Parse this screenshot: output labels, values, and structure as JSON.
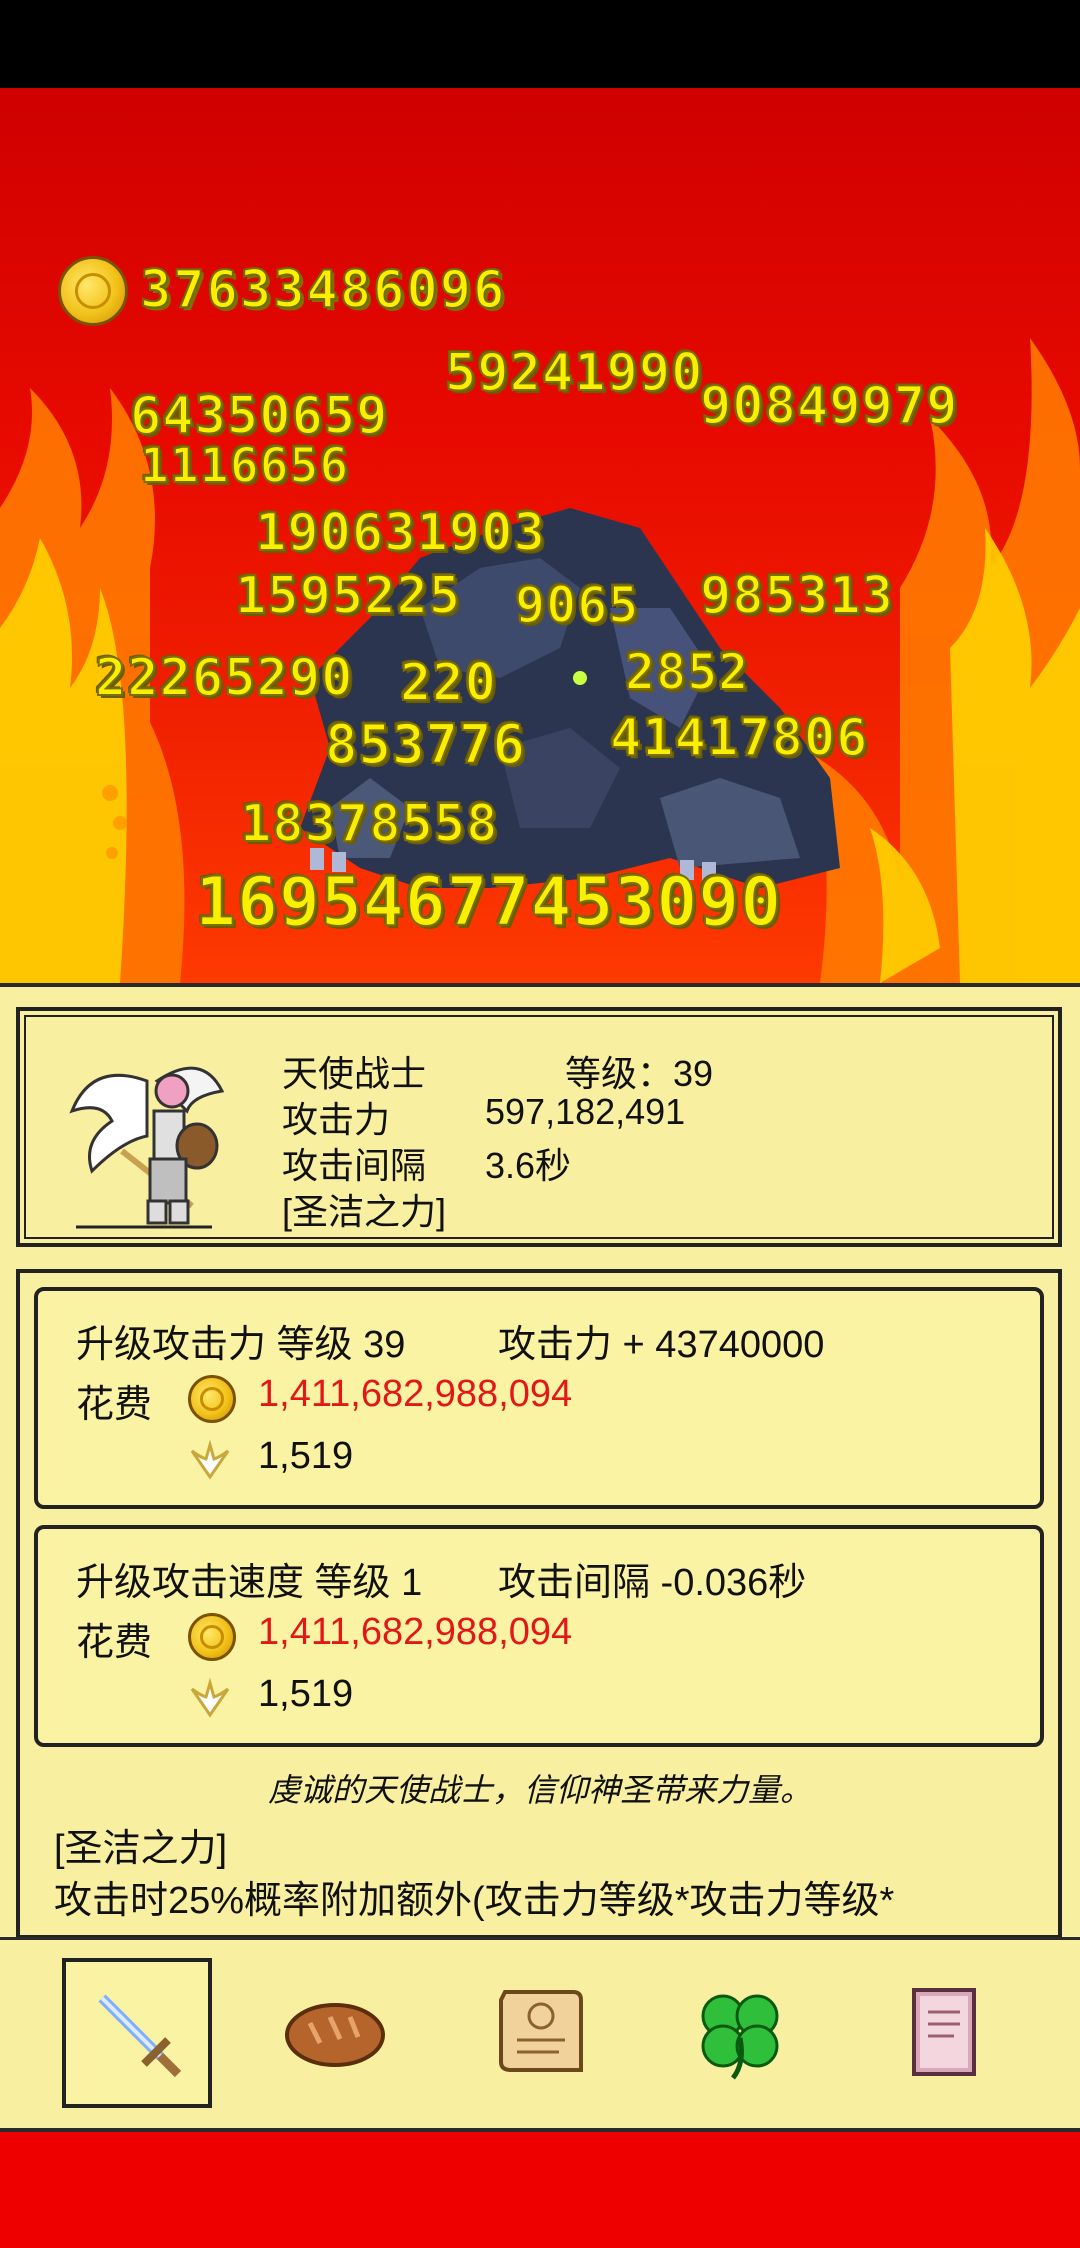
{
  "gold": {
    "icon": "gold-coin-icon",
    "amount": "37633486096"
  },
  "damage_numbers": [
    "59241990",
    "64350659",
    "90849979",
    "1116656",
    "190631903",
    "1595225",
    "9065",
    "985313",
    "22265290",
    "220",
    "2852",
    "853776",
    "41417806",
    "18378558"
  ],
  "big_damage": "16954677453090",
  "character": {
    "name": "天使战士",
    "level_label": "等级：39",
    "attack_label": "攻击力",
    "attack_value": "597,182,491",
    "interval_label": "攻击间隔",
    "interval_value": "3.6秒",
    "skill": "[圣洁之力]"
  },
  "upgrades": [
    {
      "title": "升级攻击力 等级 39",
      "effect": "攻击力 + 43740000",
      "cost_label": "花费",
      "gold_cost": "1,411,682,988,094",
      "wing_cost": "1,519"
    },
    {
      "title": "升级攻击速度 等级 1",
      "effect": "攻击间隔 -0.036秒",
      "cost_label": "花费",
      "gold_cost": "1,411,682,988,094",
      "wing_cost": "1,519"
    }
  ],
  "description": "虔诚的天使战士，信仰神圣带来力量。",
  "skill_title": "[圣洁之力]",
  "skill_detail": "攻击时25%概率附加额外(攻击力等级*攻击力等级*",
  "nav": [
    {
      "icon": "sword-icon",
      "active": true
    },
    {
      "icon": "bread-icon",
      "active": false
    },
    {
      "icon": "scroll-icon",
      "active": false
    },
    {
      "icon": "clover-icon",
      "active": false
    },
    {
      "icon": "book-icon",
      "active": false
    }
  ],
  "colors": {
    "panel": "#f8f0a0",
    "damage_text": "#f8f000",
    "cost_red": "#e21818",
    "background": "#e8000a"
  }
}
